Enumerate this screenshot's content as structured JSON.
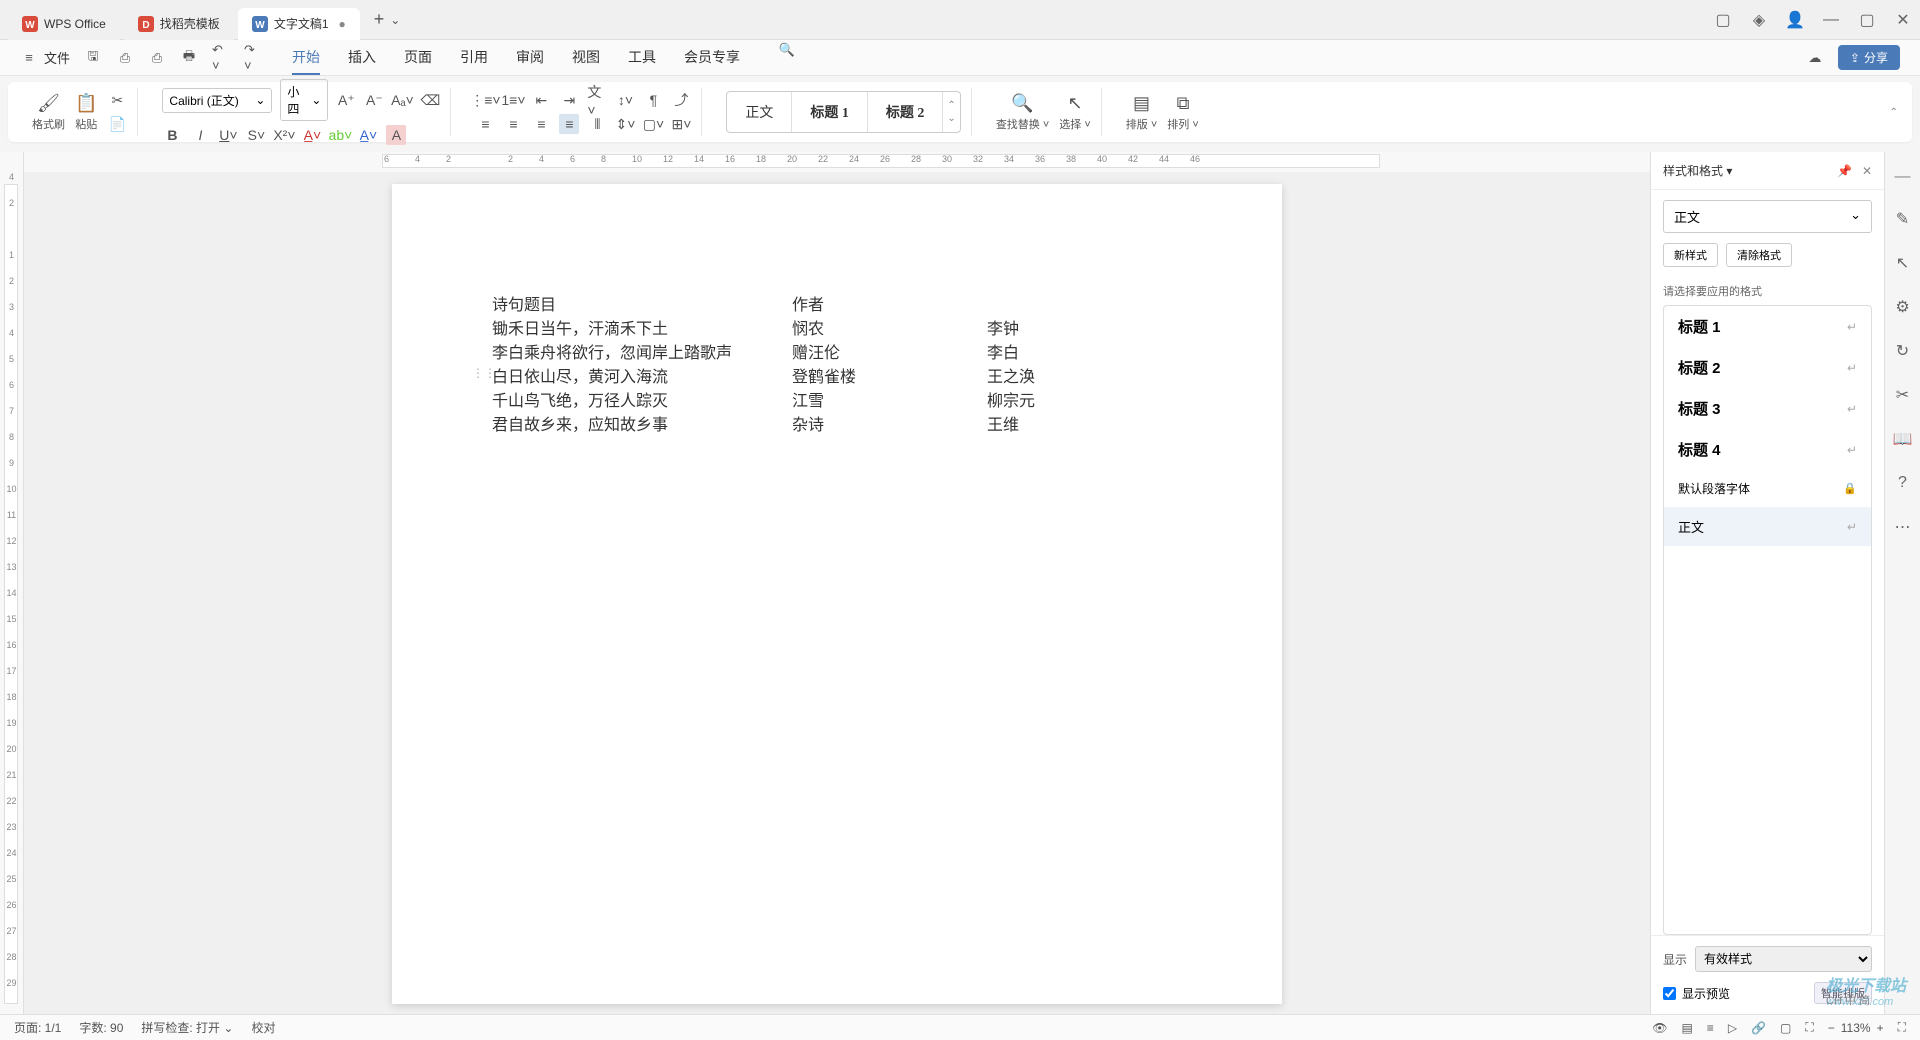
{
  "titlebar": {
    "tabs": [
      {
        "icon": "W",
        "label": "WPS Office",
        "iconColor": "#d94b3a"
      },
      {
        "icon": "D",
        "label": "找稻壳模板",
        "iconColor": "#d94b3a"
      },
      {
        "icon": "W",
        "label": "文字文稿1",
        "iconColor": "#4a7ab8"
      }
    ],
    "addSymbol": "+",
    "dropdownSymbol": "⌄"
  },
  "menubar": {
    "fileLabel": "文件",
    "tabs": [
      "开始",
      "插入",
      "页面",
      "引用",
      "审阅",
      "视图",
      "工具",
      "会员专享"
    ],
    "activeTab": "开始",
    "shareLabel": "分享"
  },
  "ribbon": {
    "formatBrush": "格式刷",
    "paste": "粘贴",
    "fontName": "Calibri (正文)",
    "fontSize": "小四",
    "styleGallery": [
      "正文",
      "标题 1",
      "标题 2"
    ],
    "findReplace": "查找替换",
    "select": "选择",
    "layout": "排版",
    "arrange": "排列"
  },
  "ruler": {
    "hTicks": [
      "6",
      "4",
      "2",
      "",
      "2",
      "4",
      "6",
      "8",
      "10",
      "12",
      "14",
      "16",
      "18",
      "20",
      "22",
      "24",
      "26",
      "28",
      "30",
      "32",
      "34",
      "36",
      "38",
      "40",
      "42",
      "44",
      "46"
    ],
    "vTicks": [
      "4",
      "2",
      "",
      "1",
      "2",
      "3",
      "4",
      "5",
      "6",
      "7",
      "8",
      "9",
      "10",
      "11",
      "12",
      "13",
      "14",
      "15",
      "16",
      "17",
      "18",
      "19",
      "20",
      "21",
      "22",
      "23",
      "24",
      "25",
      "26",
      "27",
      "28",
      "29"
    ]
  },
  "document": {
    "headers": [
      "诗句题目",
      "作者",
      ""
    ],
    "rows": [
      [
        "锄禾日当午，汗滴禾下土",
        "悯农",
        "李钟"
      ],
      [
        "李白乘舟将欲行，忽闻岸上踏歌声",
        "赠汪伦",
        "李白"
      ],
      [
        "白日依山尽，黄河入海流",
        "登鹤雀楼",
        "王之涣"
      ],
      [
        "千山鸟飞绝，万径人踪灭",
        "江雪",
        "柳宗元"
      ],
      [
        "君自故乡来，应知故乡事",
        "杂诗",
        "王维"
      ]
    ]
  },
  "sidebar": {
    "title": "样式和格式",
    "currentStyle": "正文",
    "newStyleBtn": "新样式",
    "clearFormatBtn": "清除格式",
    "selectFormatLabel": "请选择要应用的格式",
    "styles": [
      {
        "name": "标题 1",
        "suffix": "↵"
      },
      {
        "name": "标题 2",
        "suffix": "↵"
      },
      {
        "name": "标题 3",
        "suffix": "↵"
      },
      {
        "name": "标题 4",
        "suffix": "↵"
      }
    ],
    "defaultFont": "默认段落字体",
    "bodyStyle": "正文",
    "showLabel": "显示",
    "showOption": "有效样式",
    "showPreview": "显示预览",
    "smartLayout": "智能排版"
  },
  "statusbar": {
    "page": "页面: 1/1",
    "words": "字数: 90",
    "spellcheck": "拼写检查: 打开",
    "proofLabel": "校对",
    "zoom": "113%",
    "zoomMinus": "−",
    "zoomPlus": "+"
  },
  "watermark": {
    "line1": "极光下载站",
    "line2": "www.xz7.com"
  },
  "imeBadge": "CH 中 简"
}
